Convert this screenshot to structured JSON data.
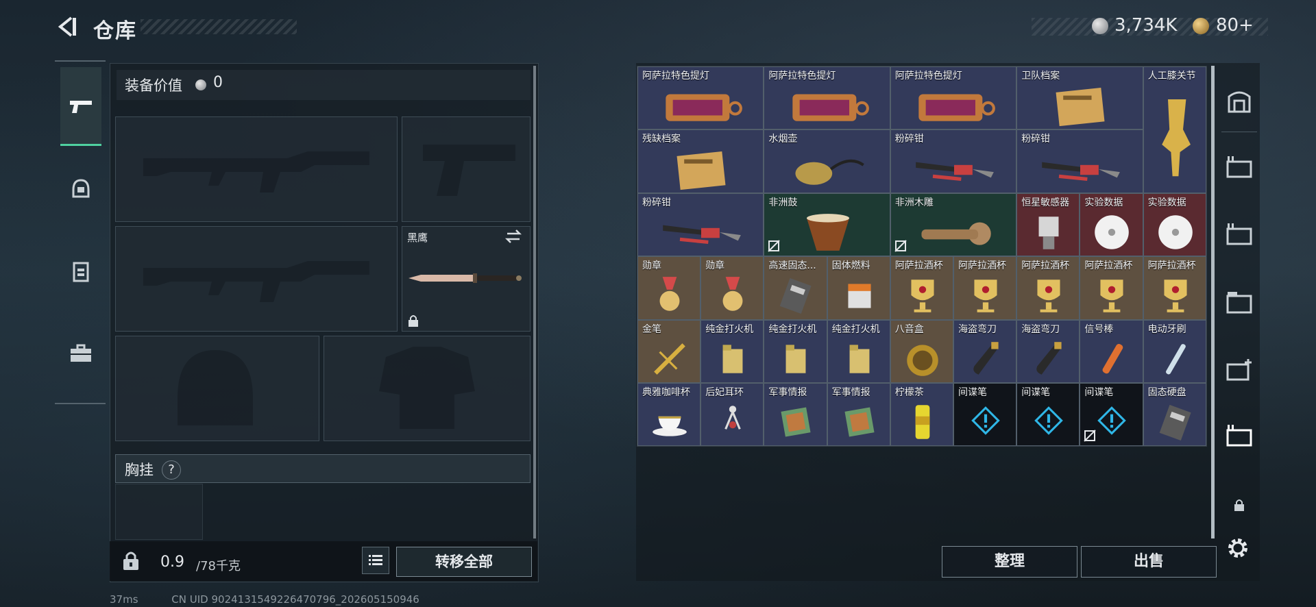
{
  "header": {
    "title": "仓库"
  },
  "currency": {
    "silver": "3,734K",
    "gold": "80+"
  },
  "equipment": {
    "label": "装备价值",
    "value": "0",
    "melee_name": "黑鹰",
    "chest_label": "胸挂",
    "chest_help": "?"
  },
  "bottom_left": {
    "weight": "0.9",
    "weight_max": "/78千克",
    "transfer_all": "转移全部"
  },
  "actions": {
    "sort": "整理",
    "sell": "出售"
  },
  "status_bar": {
    "ping": "37ms",
    "uid": "CN UID 9024131549226470796_202605150946"
  },
  "warehouse": {
    "items": [
      {
        "name": "阿萨拉特色提灯",
        "icon": "lantern-icon"
      },
      {
        "name": "阿萨拉特色提灯",
        "icon": "lantern-icon"
      },
      {
        "name": "阿萨拉特色提灯",
        "icon": "lantern-icon"
      },
      {
        "name": "卫队档案",
        "icon": "file-icon"
      },
      {
        "name": "人工膝关节",
        "icon": "knee-joint-icon"
      },
      {
        "name": "残缺档案",
        "icon": "file-icon"
      },
      {
        "name": "水烟壶",
        "icon": "hookah-icon"
      },
      {
        "name": "粉碎钳",
        "icon": "pliers-icon"
      },
      {
        "name": "粉碎钳",
        "icon": "pliers-icon"
      },
      {
        "name": "粉碎钳",
        "icon": "pliers-icon"
      },
      {
        "name": "非洲鼓",
        "icon": "drum-icon"
      },
      {
        "name": "非洲木雕",
        "icon": "wood-carving-icon"
      },
      {
        "name": "恒星敏感器",
        "icon": "sensor-icon"
      },
      {
        "name": "实验数据",
        "icon": "disc-icon"
      },
      {
        "name": "实验数据",
        "icon": "disc-icon"
      },
      {
        "name": "勋章",
        "icon": "medal-icon"
      },
      {
        "name": "勋章",
        "icon": "medal-icon"
      },
      {
        "name": "高速固态...",
        "icon": "ssd-icon"
      },
      {
        "name": "固体燃料",
        "icon": "fuel-icon"
      },
      {
        "name": "阿萨拉酒杯",
        "icon": "goblet-icon"
      },
      {
        "name": "阿萨拉酒杯",
        "icon": "goblet-icon"
      },
      {
        "name": "阿萨拉酒杯",
        "icon": "goblet-icon"
      },
      {
        "name": "阿萨拉酒杯",
        "icon": "goblet-icon"
      },
      {
        "name": "阿萨拉酒杯",
        "icon": "goblet-icon"
      },
      {
        "name": "金笔",
        "icon": "pen-icon"
      },
      {
        "name": "纯金打火机",
        "icon": "lighter-icon"
      },
      {
        "name": "纯金打火机",
        "icon": "lighter-icon"
      },
      {
        "name": "纯金打火机",
        "icon": "lighter-icon"
      },
      {
        "name": "八音盒",
        "icon": "music-box-icon"
      },
      {
        "name": "海盗弯刀",
        "icon": "machete-icon"
      },
      {
        "name": "海盗弯刀",
        "icon": "machete-icon"
      },
      {
        "name": "信号棒",
        "icon": "flare-icon"
      },
      {
        "name": "电动牙刷",
        "icon": "toothbrush-icon"
      },
      {
        "name": "典雅咖啡杯",
        "icon": "coffee-cup-icon"
      },
      {
        "name": "后妃耳环",
        "icon": "earring-icon"
      },
      {
        "name": "军事情报",
        "icon": "intel-icon"
      },
      {
        "name": "军事情报",
        "icon": "intel-icon"
      },
      {
        "name": "柠檬茶",
        "icon": "drink-can-icon"
      },
      {
        "name": "间谍笔",
        "icon": "spy-pen-icon"
      },
      {
        "name": "间谍笔",
        "icon": "spy-pen-icon"
      },
      {
        "name": "间谍笔",
        "icon": "spy-pen-icon"
      },
      {
        "name": "固态硬盘",
        "icon": "ssd-icon"
      }
    ]
  },
  "colors": {
    "accent": "#4fd1a0",
    "rarity_purple": "#333a5a",
    "rarity_gold": "#5e5040",
    "rarity_red": "#5a2a30",
    "rarity_green": "#1d3a33"
  }
}
